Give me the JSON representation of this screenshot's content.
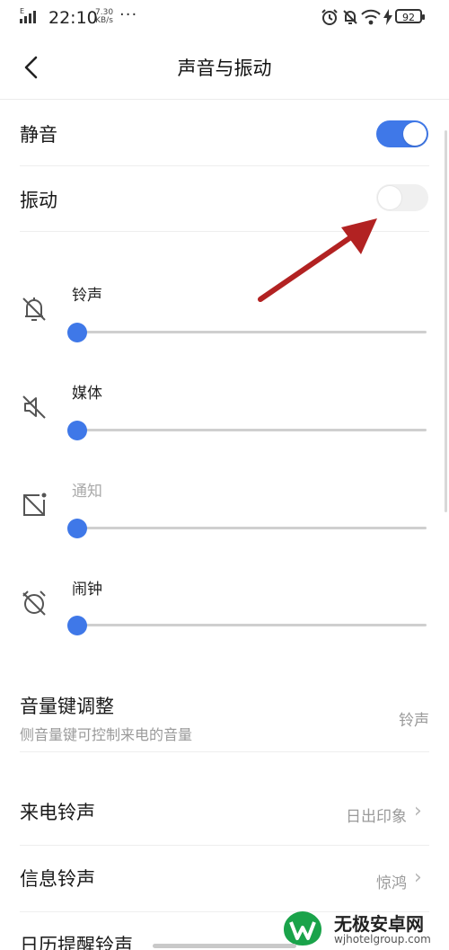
{
  "status_bar": {
    "time": "22:10",
    "net_speed_value": "7.30",
    "net_speed_unit": "KB/s",
    "overflow": "···",
    "battery": "92"
  },
  "header": {
    "title": "声音与振动"
  },
  "toggles": {
    "mute": {
      "label": "静音",
      "on": true
    },
    "vibrate": {
      "label": "振动",
      "on": false
    }
  },
  "volumes": [
    {
      "label": "铃声",
      "icon": "bell-off-icon",
      "level": 0.0,
      "enabled": true
    },
    {
      "label": "媒体",
      "icon": "speaker-mute-icon",
      "level": 0.0,
      "enabled": true
    },
    {
      "label": "通知",
      "icon": "notification-off-icon",
      "level": 0.0,
      "enabled": false
    },
    {
      "label": "闹钟",
      "icon": "alarm-off-icon",
      "level": 0.0,
      "enabled": true
    }
  ],
  "volume_key": {
    "title": "音量键调整",
    "subtitle": "侧音量键可控制来电的音量",
    "value": "铃声"
  },
  "ringtones": [
    {
      "title": "来电铃声",
      "value": "日出印象"
    },
    {
      "title": "信息铃声",
      "value": "惊鸿"
    },
    {
      "title": "日历提醒铃声",
      "value": ""
    }
  ],
  "watermark": {
    "name": "无极安卓网",
    "url": "wjhotelgroup.com"
  },
  "colors": {
    "accent": "#3f78e8",
    "annotation_arrow": "#b22222"
  }
}
